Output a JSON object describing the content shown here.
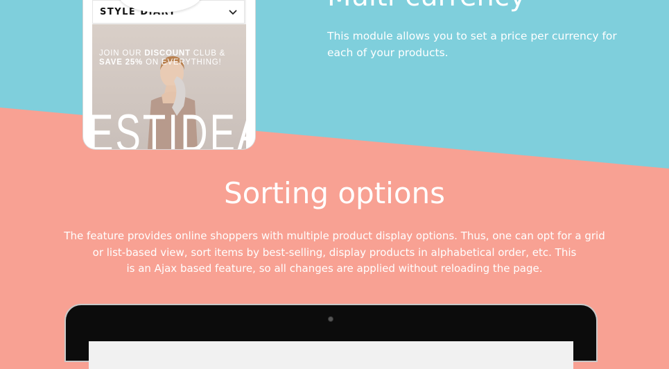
{
  "colors": {
    "top_bg": "#7fcfdc",
    "bottom_bg": "#f8a193",
    "text": "#ffffff"
  },
  "phone": {
    "menu_label": "STYLE  DIARY",
    "menu_icon": "chevron-down-icon",
    "promo_line1_pre": "JOIN OUR ",
    "promo_line1_bold": "DISCOUNT",
    "promo_line1_post": " CLUB &",
    "promo_line2_bold": "SAVE 25%",
    "promo_line2_post": " ON EVERYTHING!",
    "brand_text": "ESTIDEA"
  },
  "multicurrency": {
    "title": "Multi-currency",
    "description": "This module allows you to set a price per currency for each of your products."
  },
  "sorting": {
    "title": "Sorting options",
    "description_lines": [
      "The feature provides online shoppers with multiple product display options. Thus, one can opt for a grid",
      "or list-based view, sort items by best-selling, display products in alphabetical order, etc. This",
      "is an Ajax based feature, so all changes are applied without reloading the page."
    ]
  }
}
